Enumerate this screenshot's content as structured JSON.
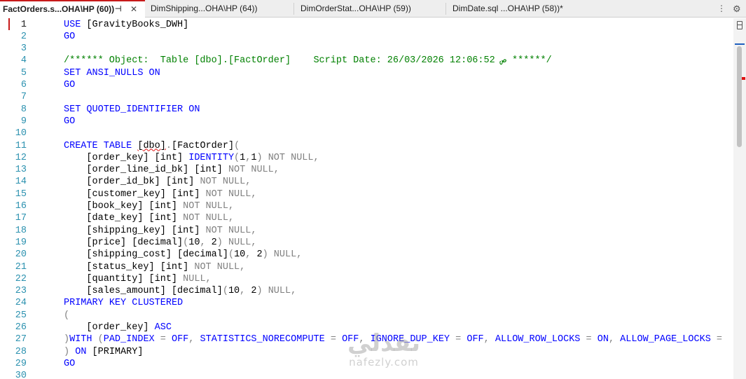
{
  "tabs": [
    {
      "label": "FactOrders.s...OHA\\HP (60))",
      "pin": "⊣",
      "close": "✕",
      "active": true
    },
    {
      "label": "DimShipping...OHA\\HP (64))"
    },
    {
      "label": "DimOrderStat...OHA\\HP (59))"
    },
    {
      "label": "DimDate.sql ...OHA\\HP (58))*"
    }
  ],
  "toolbar": {
    "overflow": "⋮",
    "settings": "⚙"
  },
  "colors": {
    "keyword": "#0000ff",
    "comment": "#008000",
    "operator": "#808080",
    "function": "#ff00ff",
    "line_number": "#2b91af",
    "error": "#e01010"
  },
  "lines": [
    {
      "n": "1",
      "segs": [
        [
          "k",
          "USE"
        ],
        [
          "t",
          " [GravityBooks_DWH]"
        ]
      ]
    },
    {
      "n": "2",
      "segs": [
        [
          "k",
          "GO"
        ]
      ]
    },
    {
      "n": "3",
      "segs": []
    },
    {
      "n": "4",
      "segs": [
        [
          "c",
          "/****** Object:  Table [dbo].[FactOrder]    Script Date: 26/03/2026 12:06:52 ص ******/"
        ]
      ]
    },
    {
      "n": "5",
      "segs": [
        [
          "k",
          "SET"
        ],
        [
          "t",
          " "
        ],
        [
          "k",
          "ANSI_NULLS"
        ],
        [
          "t",
          " "
        ],
        [
          "k",
          "ON"
        ]
      ]
    },
    {
      "n": "6",
      "segs": [
        [
          "k",
          "GO"
        ]
      ]
    },
    {
      "n": "7",
      "segs": []
    },
    {
      "n": "8",
      "segs": [
        [
          "k",
          "SET"
        ],
        [
          "t",
          " "
        ],
        [
          "k",
          "QUOTED_IDENTIFIER"
        ],
        [
          "t",
          " "
        ],
        [
          "k",
          "ON"
        ]
      ]
    },
    {
      "n": "9",
      "segs": [
        [
          "k",
          "GO"
        ]
      ]
    },
    {
      "n": "10",
      "segs": []
    },
    {
      "n": "11",
      "segs": [
        [
          "k",
          "CREATE"
        ],
        [
          "t",
          " "
        ],
        [
          "k",
          "TABLE"
        ],
        [
          "t",
          " "
        ],
        [
          "sq",
          "[dbo]"
        ],
        [
          "g",
          "."
        ],
        [
          "t",
          "[FactOrder]"
        ],
        [
          "g",
          "("
        ]
      ]
    },
    {
      "n": "12",
      "segs": [
        [
          "t",
          "    [order_key] [int] "
        ],
        [
          "k",
          "IDENTITY"
        ],
        [
          "g",
          "("
        ],
        [
          "t",
          "1"
        ],
        [
          "g",
          ","
        ],
        [
          "t",
          "1"
        ],
        [
          "g",
          ")"
        ],
        [
          "t",
          " "
        ],
        [
          "g",
          "NOT NULL,"
        ]
      ]
    },
    {
      "n": "13",
      "segs": [
        [
          "t",
          "    [order_line_id_bk] [int] "
        ],
        [
          "g",
          "NOT NULL,"
        ]
      ]
    },
    {
      "n": "14",
      "segs": [
        [
          "t",
          "    [order_id_bk] [int] "
        ],
        [
          "g",
          "NOT NULL,"
        ]
      ]
    },
    {
      "n": "15",
      "segs": [
        [
          "t",
          "    [customer_key] [int] "
        ],
        [
          "g",
          "NOT NULL,"
        ]
      ]
    },
    {
      "n": "16",
      "segs": [
        [
          "t",
          "    [book_key] [int] "
        ],
        [
          "g",
          "NOT NULL,"
        ]
      ]
    },
    {
      "n": "17",
      "segs": [
        [
          "t",
          "    [date_key] [int] "
        ],
        [
          "g",
          "NOT NULL,"
        ]
      ]
    },
    {
      "n": "18",
      "segs": [
        [
          "t",
          "    [shipping_key] [int] "
        ],
        [
          "g",
          "NOT NULL,"
        ]
      ]
    },
    {
      "n": "19",
      "segs": [
        [
          "t",
          "    [price] [decimal]"
        ],
        [
          "g",
          "("
        ],
        [
          "t",
          "10"
        ],
        [
          "g",
          ","
        ],
        [
          "t",
          " 2"
        ],
        [
          "g",
          ")"
        ],
        [
          "t",
          " "
        ],
        [
          "g",
          "NULL,"
        ]
      ]
    },
    {
      "n": "20",
      "segs": [
        [
          "t",
          "    [shipping_cost] [decimal]"
        ],
        [
          "g",
          "("
        ],
        [
          "t",
          "10"
        ],
        [
          "g",
          ","
        ],
        [
          "t",
          " 2"
        ],
        [
          "g",
          ")"
        ],
        [
          "t",
          " "
        ],
        [
          "g",
          "NULL,"
        ]
      ]
    },
    {
      "n": "21",
      "segs": [
        [
          "t",
          "    [status_key] [int] "
        ],
        [
          "g",
          "NOT NULL,"
        ]
      ]
    },
    {
      "n": "22",
      "segs": [
        [
          "t",
          "    [quantity] [int] "
        ],
        [
          "g",
          "NULL,"
        ]
      ]
    },
    {
      "n": "23",
      "segs": [
        [
          "t",
          "    [sales_amount] [decimal]"
        ],
        [
          "g",
          "("
        ],
        [
          "t",
          "10"
        ],
        [
          "g",
          ","
        ],
        [
          "t",
          " 2"
        ],
        [
          "g",
          ")"
        ],
        [
          "t",
          " "
        ],
        [
          "g",
          "NULL,"
        ]
      ]
    },
    {
      "n": "24",
      "segs": [
        [
          "k",
          "PRIMARY"
        ],
        [
          "t",
          " "
        ],
        [
          "k",
          "KEY"
        ],
        [
          "t",
          " "
        ],
        [
          "k",
          "CLUSTERED"
        ]
      ]
    },
    {
      "n": "25",
      "segs": [
        [
          "g",
          "("
        ]
      ]
    },
    {
      "n": "26",
      "segs": [
        [
          "t",
          "    [order_key] "
        ],
        [
          "k",
          "ASC"
        ]
      ]
    },
    {
      "n": "27",
      "segs": [
        [
          "g",
          ")"
        ],
        [
          "k",
          "WITH"
        ],
        [
          "t",
          " "
        ],
        [
          "g",
          "("
        ],
        [
          "k",
          "PAD_INDEX"
        ],
        [
          "t",
          " "
        ],
        [
          "g",
          "="
        ],
        [
          "t",
          " "
        ],
        [
          "k",
          "OFF"
        ],
        [
          "g",
          ","
        ],
        [
          "t",
          " "
        ],
        [
          "k",
          "STATISTICS_NORECOMPUTE"
        ],
        [
          "t",
          " "
        ],
        [
          "g",
          "="
        ],
        [
          "t",
          " "
        ],
        [
          "k",
          "OFF"
        ],
        [
          "g",
          ","
        ],
        [
          "t",
          " "
        ],
        [
          "k",
          "IGNORE_DUP_KEY"
        ],
        [
          "t",
          " "
        ],
        [
          "g",
          "="
        ],
        [
          "t",
          " "
        ],
        [
          "k",
          "OFF"
        ],
        [
          "g",
          ","
        ],
        [
          "t",
          " "
        ],
        [
          "k",
          "ALLOW_ROW_LOCKS"
        ],
        [
          "t",
          " "
        ],
        [
          "g",
          "="
        ],
        [
          "t",
          " "
        ],
        [
          "k",
          "ON"
        ],
        [
          "g",
          ","
        ],
        [
          "t",
          " "
        ],
        [
          "k",
          "ALLOW_PAGE_LOCKS"
        ],
        [
          "t",
          " "
        ],
        [
          "g",
          "="
        ]
      ]
    },
    {
      "n": "28",
      "segs": [
        [
          "g",
          ")"
        ],
        [
          "t",
          " "
        ],
        [
          "k",
          "ON"
        ],
        [
          "t",
          " [PRIMARY]"
        ]
      ]
    },
    {
      "n": "29",
      "segs": [
        [
          "k",
          "GO"
        ]
      ]
    },
    {
      "n": "30",
      "segs": []
    }
  ],
  "watermark": {
    "logo": "نفذلي",
    "text": "nafezly.com"
  }
}
